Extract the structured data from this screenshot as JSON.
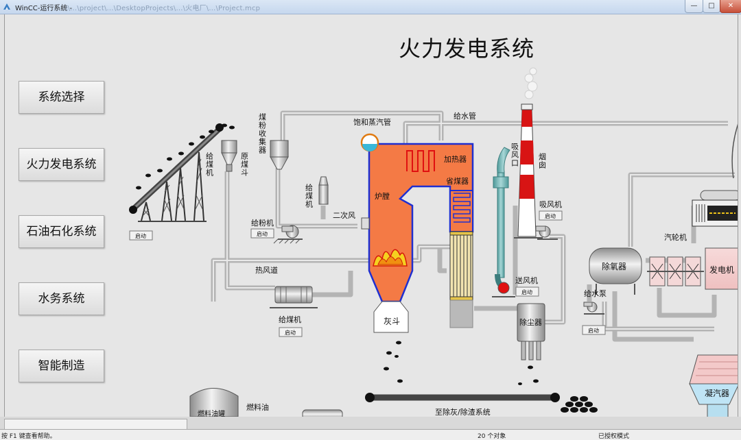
{
  "window": {
    "title": "WinCC-运行系统 -",
    "path": "\\\\...\\project\\...\\DesktopProjects\\...\\火电厂\\...\\Project.mcp",
    "min_glyph": "—",
    "max_glyph": "□",
    "close_glyph": "✕"
  },
  "main_title": "火力发电系统",
  "nav": [
    {
      "label": "系统选择"
    },
    {
      "label": "火力发电系统"
    },
    {
      "label": "石油石化系统"
    },
    {
      "label": "水务系统"
    },
    {
      "label": "智能制造"
    }
  ],
  "diagram": {
    "labels": {
      "feeder_conveyor": "给煤机",
      "raw_coal_hopper": "原煤斗",
      "pulverized_coal_collector": "煤粉收集器",
      "coal_feeder_small": "给煤机",
      "powder_feeder": "给粉机",
      "secondary_air": "二次风",
      "hot_air_duct": "热风道",
      "coal_feeder_bottom": "给煤机",
      "saturated_steam_pipe": "饱和蒸汽管",
      "feedwater_pipe": "给水管",
      "heater": "加热器",
      "economizer": "省煤器",
      "furnace": "炉膛",
      "ash_hopper": "灰斗",
      "suction_inlet": "吸风口",
      "chimney": "烟囱",
      "induced_fan": "吸风机",
      "forced_fan": "送风机",
      "dust_collector": "除尘器",
      "deaerator": "除氧器",
      "feed_pump": "给水泵",
      "turbine": "汽轮机",
      "generator": "发电机",
      "condenser": "凝汽器",
      "fuel_oil": "燃料油",
      "fuel_tank": "燃料油罐",
      "ash_removal": "至除灰/除渣系统"
    },
    "start_label": "启动"
  },
  "status": {
    "help": "按 F1 键查看帮助。",
    "objects": "20 个对象",
    "mode": "已授权模式"
  }
}
